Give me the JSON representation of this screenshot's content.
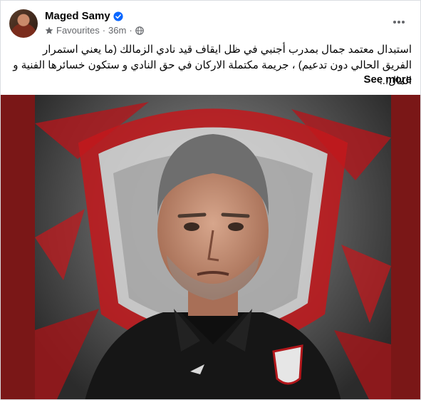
{
  "post": {
    "author": "Maged Samy",
    "audience": "Favourites",
    "time": "36m",
    "separator": "·",
    "text": "استبدال معتمد جمال بمدرب أجنبي في ظل ايقاف قيد نادي الزمالك (ما يعني استمرار الفريق الحالي دون تدعيم) ، جريمة مكتملة الاركان في حق النادي و ستكون خسائرها الفنية و المال...",
    "see_more": "See more"
  },
  "icons": {
    "verified": "verified-badge-icon",
    "favourites": "star-icon",
    "privacy": "globe-icon",
    "options": "more-options-icon"
  },
  "colors": {
    "verified_blue": "#0866ff",
    "meta_gray": "#65676b",
    "photo_border_red": "#7a1717"
  }
}
